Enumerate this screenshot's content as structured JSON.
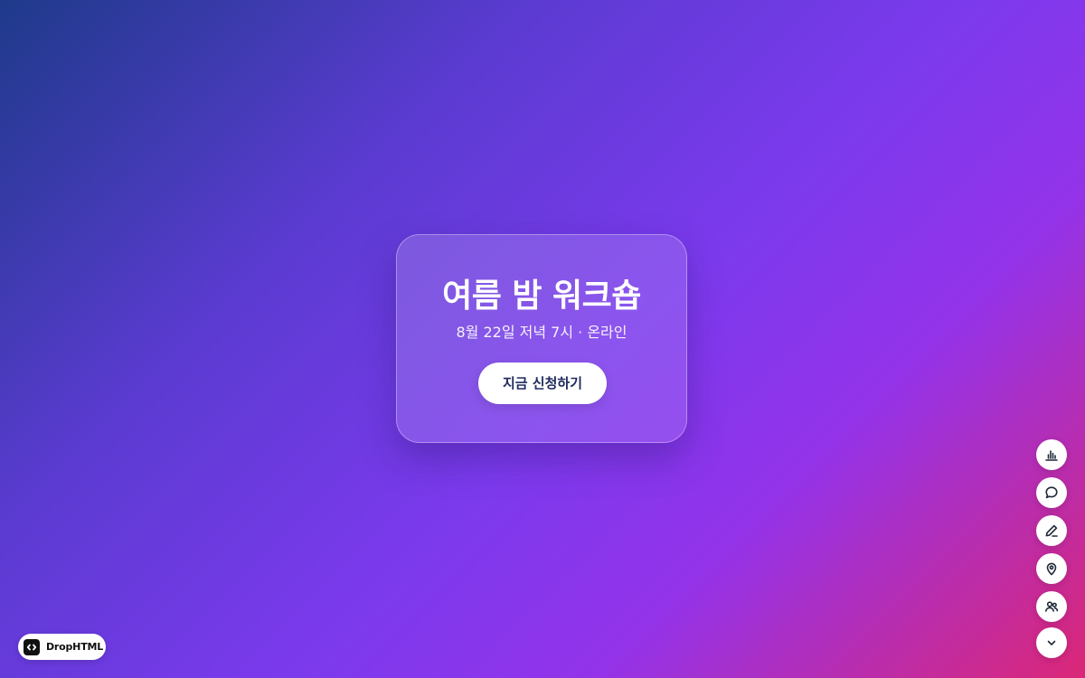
{
  "card": {
    "title": "여름 밤 워크숍",
    "subtitle": "8월 22일 저녁 7시 · 온라인",
    "cta_label": "지금 신청하기"
  },
  "side_actions": [
    {
      "icon": "bar-chart-icon"
    },
    {
      "icon": "chat-bubble-icon"
    },
    {
      "icon": "pencil-icon"
    },
    {
      "icon": "map-pin-icon"
    },
    {
      "icon": "users-icon"
    },
    {
      "icon": "chevron-down-icon"
    }
  ],
  "badge": {
    "label": "DropHTML",
    "icon": "code-icon"
  },
  "colors": {
    "gradient_start": "#1e3a8a",
    "gradient_mid": "#7c3aed",
    "gradient_end": "#db2777",
    "cta_text": "#1e2a5c"
  }
}
